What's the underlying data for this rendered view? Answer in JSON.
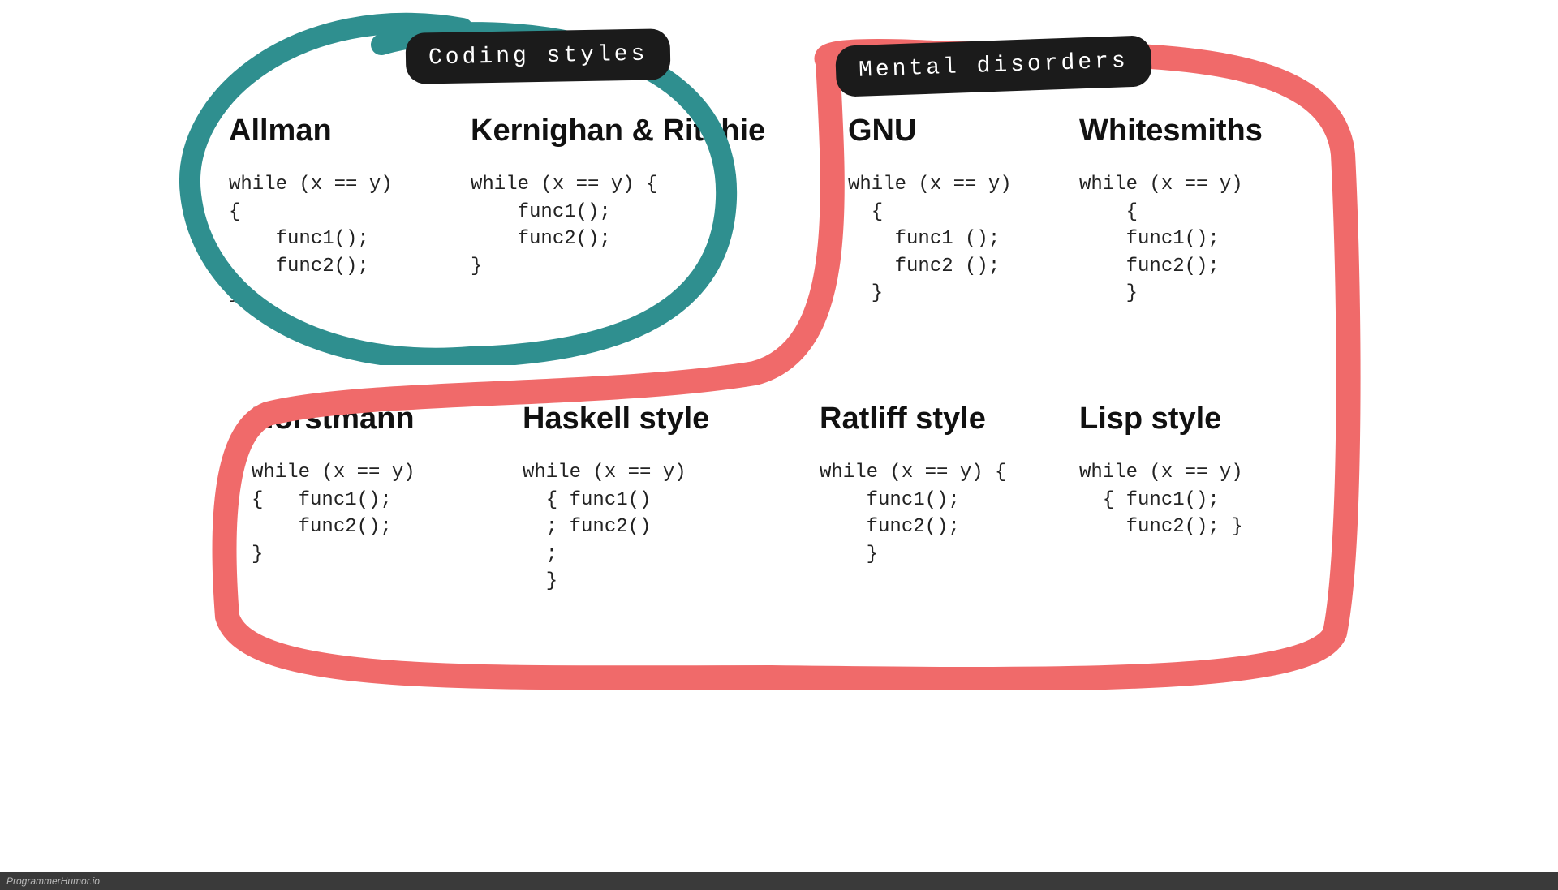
{
  "labels": {
    "coding": "Coding styles",
    "disorders": "Mental disorders"
  },
  "styles": {
    "allman": {
      "title": "Allman",
      "code": "while (x == y)\n{\n    func1();\n    func2();\n}"
    },
    "kr": {
      "title": "Kernighan & Ritchie",
      "code": "while (x == y) {\n    func1();\n    func2();\n}"
    },
    "gnu": {
      "title": "GNU",
      "code": "while (x == y)\n  {\n    func1 ();\n    func2 ();\n  }"
    },
    "whitesmiths": {
      "title": "Whitesmiths",
      "code": "while (x == y)\n    {\n    func1();\n    func2();\n    }"
    },
    "horstmann": {
      "title": "Horstmann",
      "code": "while (x == y)\n{   func1();\n    func2();\n}"
    },
    "haskell": {
      "title": "Haskell style",
      "code": "while (x == y)\n  { func1()\n  ; func2()\n  ;\n  }"
    },
    "ratliff": {
      "title": "Ratliff style",
      "code": "while (x == y) {\n    func1();\n    func2();\n    }"
    },
    "lisp": {
      "title": "Lisp style",
      "code": "while (x == y)\n  { func1();\n    func2(); }"
    }
  },
  "footer": "ProgrammerHumor.io",
  "colors": {
    "teal": "#2f8f8f",
    "red": "#f06a6a"
  }
}
